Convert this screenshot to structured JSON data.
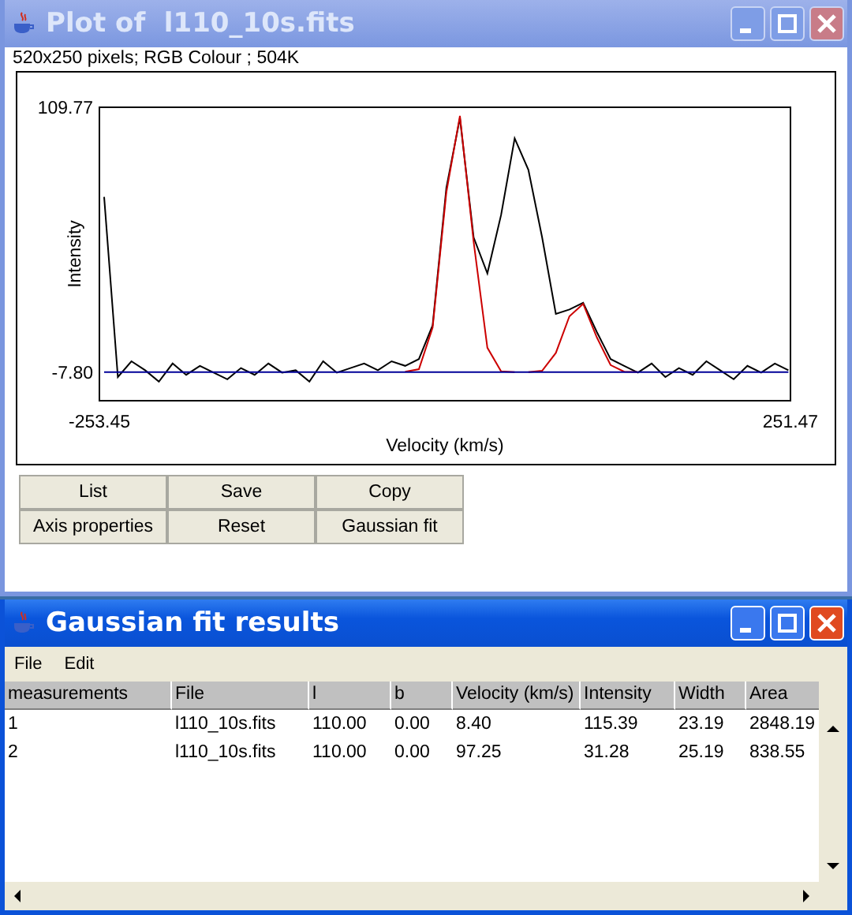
{
  "plot_window": {
    "title": "Plot of  l110_10s.fits",
    "active": false,
    "info": "520x250 pixels; RGB Colour ; 504K",
    "chart_data": {
      "type": "line",
      "xlabel": "Velocity (km/s)",
      "ylabel": "Intensity",
      "x": [
        -250,
        -240,
        -230,
        -220,
        -210,
        -200,
        -190,
        -180,
        -170,
        -160,
        -150,
        -140,
        -130,
        -120,
        -110,
        -100,
        -90,
        -80,
        -70,
        -60,
        -50,
        -40,
        -30,
        -20,
        -10,
        0,
        10,
        20,
        30,
        40,
        50,
        60,
        70,
        80,
        90,
        100,
        110,
        120,
        130,
        140,
        150,
        160,
        170,
        180,
        190,
        200,
        210,
        220,
        230,
        240,
        250
      ],
      "series": [
        {
          "color": "#000000",
          "values": [
            70,
            -10,
            -3,
            -7,
            -12,
            -4,
            -9,
            -5,
            -8,
            -11,
            -6,
            -9,
            -4,
            -8,
            -7,
            -12,
            -3,
            -8,
            -6,
            -4,
            -7,
            -3,
            -5,
            -2,
            13,
            74,
            105,
            52,
            36,
            62,
            96,
            82,
            52,
            18,
            20,
            23,
            10,
            -2,
            -5,
            -8,
            -4,
            -10,
            -6,
            -9,
            -3,
            -7,
            -11,
            -5,
            -8,
            -4,
            -7
          ]
        },
        {
          "color": "#cc0000",
          "values": [
            null,
            null,
            null,
            null,
            null,
            null,
            null,
            null,
            null,
            null,
            null,
            null,
            null,
            null,
            null,
            null,
            null,
            null,
            null,
            null,
            null,
            null,
            -7.6,
            -6.5,
            12,
            72,
            106,
            50,
            3,
            -7.5,
            -7.8,
            null,
            null,
            null,
            null,
            null,
            null,
            null,
            null,
            null,
            null,
            null,
            null,
            null,
            null,
            null,
            null,
            null,
            null,
            null,
            null
          ]
        },
        {
          "color": "#cc0000",
          "values": [
            null,
            null,
            null,
            null,
            null,
            null,
            null,
            null,
            null,
            null,
            null,
            null,
            null,
            null,
            null,
            null,
            null,
            null,
            null,
            null,
            null,
            null,
            null,
            null,
            null,
            null,
            null,
            null,
            null,
            null,
            null,
            -7.8,
            -7.2,
            0.7,
            17,
            22.5,
            7.6,
            -4.7,
            -7.6,
            -7.8,
            null,
            null,
            null,
            null,
            null,
            null,
            null,
            null,
            null,
            null,
            null
          ]
        },
        {
          "color": "#000099",
          "values": [
            -7.8,
            -7.8,
            -7.8,
            -7.8,
            -7.8,
            -7.8,
            -7.8,
            -7.8,
            -7.8,
            -7.8,
            -7.8,
            -7.8,
            -7.8,
            -7.8,
            -7.8,
            -7.8,
            -7.8,
            -7.8,
            -7.8,
            -7.8,
            -7.8,
            -7.8,
            -7.8,
            -7.8,
            -7.8,
            -7.8,
            -7.8,
            -7.8,
            -7.8,
            -7.8,
            -7.8,
            -7.8,
            -7.8,
            -7.8,
            -7.8,
            -7.8,
            -7.8,
            -7.8,
            -7.8,
            -7.8,
            -7.8,
            -7.8,
            -7.8,
            -7.8,
            -7.8,
            -7.8,
            -7.8,
            -7.8,
            -7.8,
            -7.8,
            -7.8
          ]
        }
      ],
      "xlim": [
        -253.45,
        251.47
      ],
      "ylim": [
        -20.5,
        109.77
      ],
      "xticks": [
        {
          "value": -253.45,
          "label": "-253.45"
        },
        {
          "value": 251.47,
          "label": "251.47"
        }
      ],
      "yticks": [
        {
          "value": -7.8,
          "label": "-7.80"
        },
        {
          "value": 109.77,
          "label": "109.77"
        }
      ]
    },
    "buttons": [
      "List",
      "Save",
      "Copy",
      "Axis properties",
      "Reset",
      "Gaussian fit"
    ]
  },
  "results_window": {
    "title": "Gaussian fit results",
    "active": true,
    "menu": [
      "File",
      "Edit"
    ],
    "table": {
      "columns": [
        "measurements",
        "File",
        "l",
        "b",
        "Velocity (km/s)",
        "Intensity",
        "Width",
        "Area"
      ],
      "rows": [
        [
          "1",
          "l110_10s.fits",
          "110.00",
          "0.00",
          "8.40",
          "115.39",
          "23.19",
          "2848.19"
        ],
        [
          "2",
          "l110_10s.fits",
          "110.00",
          "0.00",
          "97.25",
          "31.28",
          "25.19",
          "838.55"
        ]
      ]
    }
  }
}
